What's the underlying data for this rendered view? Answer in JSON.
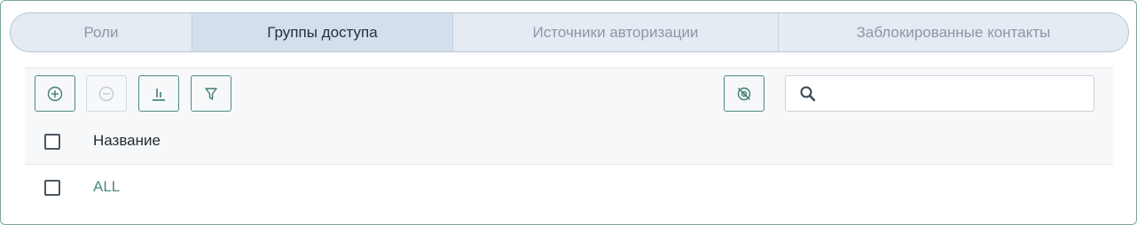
{
  "tabs": [
    {
      "label": "Роли",
      "active": false
    },
    {
      "label": "Группы доступа",
      "active": true
    },
    {
      "label": "Источники авторизации",
      "active": false
    },
    {
      "label": "Заблокированные контакты",
      "active": false
    }
  ],
  "toolbar": {
    "add_icon": "plus-circle-icon",
    "remove_icon": "minus-circle-icon",
    "stats_icon": "bar-chart-icon",
    "filter_icon": "filter-icon",
    "hide_icon": "eye-off-icon",
    "search": {
      "value": "",
      "placeholder": ""
    }
  },
  "table": {
    "columns": [
      "Название"
    ],
    "rows": [
      {
        "name": "ALL"
      }
    ]
  },
  "colors": {
    "accent": "#4f8b81",
    "tab_bg": "#e4ebf3",
    "tab_active_bg": "#d3dfea"
  }
}
